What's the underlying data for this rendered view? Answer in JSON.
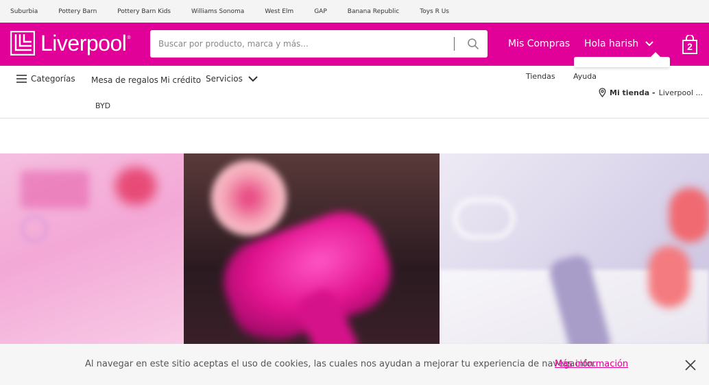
{
  "topbar": {
    "links": [
      "Suburbia",
      "Pottery Barn",
      "Pottery Barn Kids",
      "Williams Sonoma",
      "West Elm",
      "GAP",
      "Banana Republic",
      "Toys R Us"
    ]
  },
  "header": {
    "logo_text": "Liverpool",
    "logo_mark": "®",
    "search_placeholder": "Buscar por producto, marca y más...",
    "mis_compras": "Mis Compras",
    "greeting": "Hola harish",
    "cart_count": "2",
    "brand_color": "#e10098"
  },
  "nav": {
    "categorias": "Categorías",
    "mesa": "Mesa de regalos",
    "credito": "Mi crédito",
    "servicios": "Servicios",
    "byd": "BYD",
    "tiendas": "Tiendas",
    "ayuda": "Ayuda",
    "mi_tienda_label": "Mi tienda -",
    "mi_tienda_value": "Liverpool ..."
  },
  "cookie": {
    "text": "Al navegar en este sitio aceptas el uso de cookies, las cuales nos ayudan a mejorar tu experiencia de navegación.",
    "link": "Más información"
  },
  "icons": {
    "search": "search-icon",
    "menu": "hamburger-icon",
    "chevron": "chevron-down-icon",
    "cart": "shopping-bag-icon",
    "location": "location-pin-icon",
    "close": "close-icon"
  }
}
